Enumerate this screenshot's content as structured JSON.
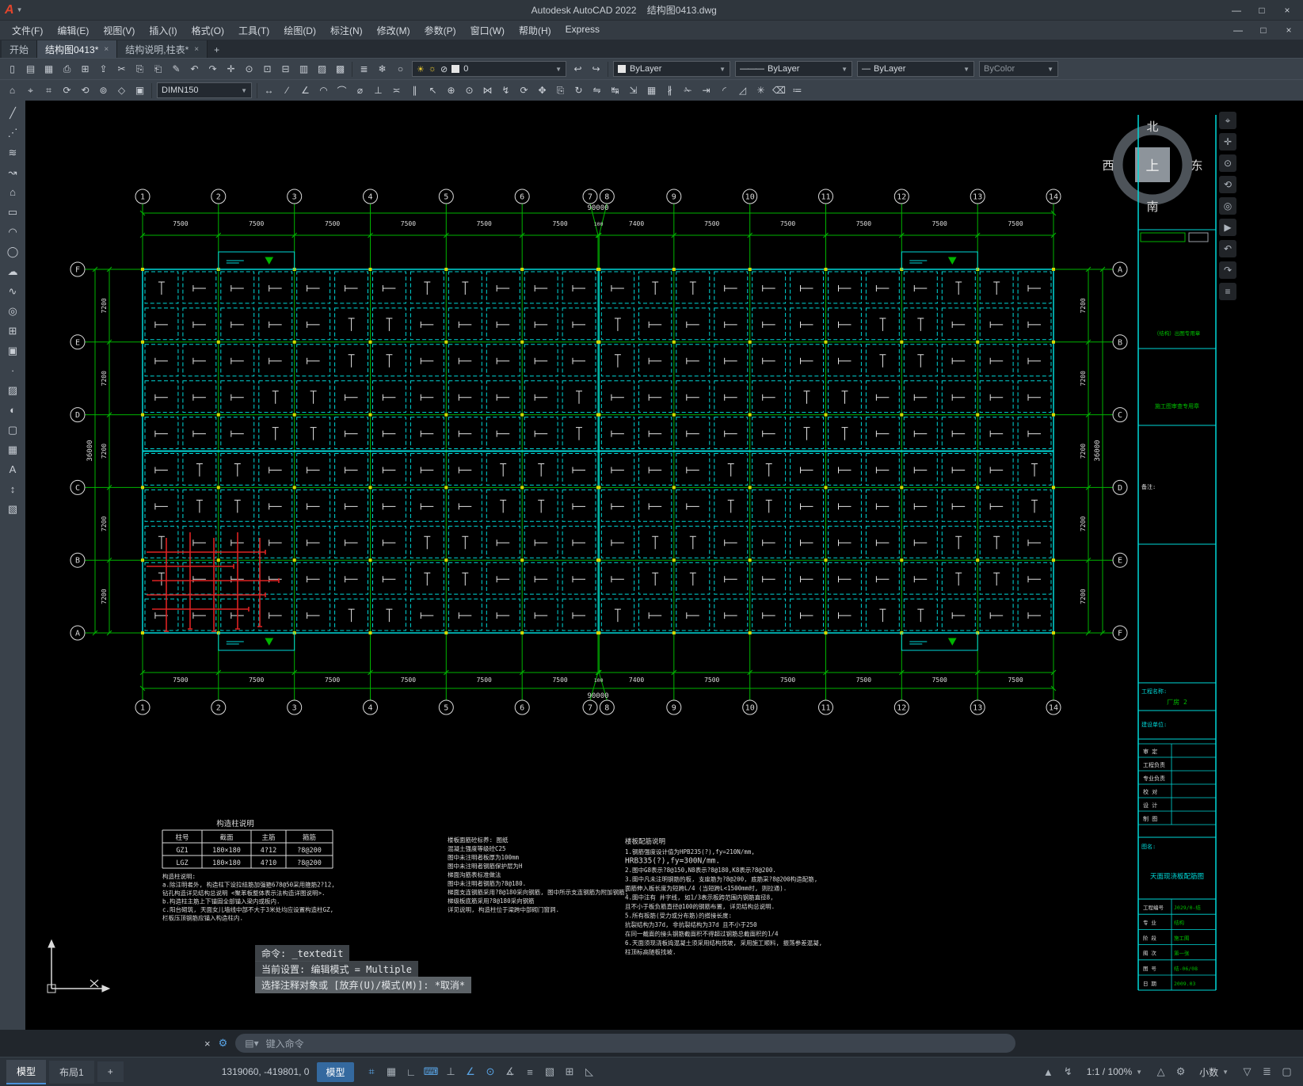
{
  "colors": {
    "grid_green": "#00b400",
    "dash_cyan": "#00d8d8",
    "text_white": "#dcdcdc",
    "rebar_red": "#dd2222",
    "column_yellow": "#d6d600",
    "accent_blue": "#4a90d9"
  },
  "window": {
    "app_title": "Autodesk AutoCAD 2022",
    "doc_title": "结构图0413.dwg",
    "min": "—",
    "max": "□",
    "close": "×"
  },
  "menu": {
    "items": [
      "文件(F)",
      "编辑(E)",
      "视图(V)",
      "插入(I)",
      "格式(O)",
      "工具(T)",
      "绘图(D)",
      "标注(N)",
      "修改(M)",
      "参数(P)",
      "窗口(W)",
      "帮助(H)",
      "Express"
    ]
  },
  "file_tabs": {
    "items": [
      {
        "label": "开始",
        "active": false,
        "closable": false
      },
      {
        "label": "结构图0413*",
        "active": true,
        "closable": true
      },
      {
        "label": "结构说明,柱表*",
        "active": false,
        "closable": true
      }
    ],
    "add_label": "+"
  },
  "toolbar1": {
    "icons": [
      {
        "name": "qnew",
        "glyph": "▯"
      },
      {
        "name": "open",
        "glyph": "▤"
      },
      {
        "name": "save",
        "glyph": "▦"
      },
      {
        "name": "plot",
        "glyph": "⎙"
      },
      {
        "name": "plot-preview",
        "glyph": "⊞"
      },
      {
        "name": "publish",
        "glyph": "⇪"
      },
      {
        "name": "cut",
        "glyph": "✂"
      },
      {
        "name": "copy-clip",
        "glyph": "⎘"
      },
      {
        "name": "paste",
        "glyph": "⎗"
      },
      {
        "name": "match-properties",
        "glyph": "✎"
      },
      {
        "name": "undo",
        "glyph": "↶"
      },
      {
        "name": "redo",
        "glyph": "↷"
      },
      {
        "name": "pan-realtime",
        "glyph": "✛"
      },
      {
        "name": "zoom-realtime",
        "glyph": "⊙"
      },
      {
        "name": "zoom-window",
        "glyph": "⊡"
      },
      {
        "name": "zoom-previous",
        "glyph": "⊟"
      },
      {
        "name": "sheet-set-manager",
        "glyph": "▥"
      },
      {
        "name": "markup",
        "glyph": "▨"
      },
      {
        "name": "quick-calc",
        "glyph": "▩"
      }
    ],
    "icons2": [
      {
        "name": "layer-properties",
        "glyph": "≣"
      },
      {
        "name": "layer-freeze",
        "glyph": "❄"
      },
      {
        "name": "layer-off",
        "glyph": "○"
      },
      {
        "name": "make-object-layer-current",
        "glyph": "↩"
      },
      {
        "name": "layer-previous",
        "glyph": "↪"
      }
    ],
    "layer_combo": {
      "value": "0"
    },
    "color_combo": "ByLayer",
    "linetype_combo": "ByLayer",
    "lineweight_combo": "ByLayer",
    "plotstyle_combo": "ByColor"
  },
  "toolbar2": {
    "dim_style": "DIMN150",
    "icons_left": [
      {
        "name": "workspace",
        "glyph": "⌂"
      },
      {
        "name": "ucs",
        "glyph": "⌖"
      },
      {
        "name": "units",
        "glyph": "⌗"
      },
      {
        "name": "redraw",
        "glyph": "⟳"
      },
      {
        "name": "regen",
        "glyph": "⟲"
      },
      {
        "name": "osnap-settings",
        "glyph": "⊚"
      },
      {
        "name": "isoplane",
        "glyph": "◇"
      },
      {
        "name": "group",
        "glyph": "▣"
      }
    ],
    "icons_right": [
      {
        "name": "dim-linear",
        "glyph": "↔"
      },
      {
        "name": "dim-aligned",
        "glyph": "∕"
      },
      {
        "name": "dim-angular",
        "glyph": "∠"
      },
      {
        "name": "dim-arc-length",
        "glyph": "◠"
      },
      {
        "name": "dim-radius",
        "glyph": "⌒"
      },
      {
        "name": "dim-diameter",
        "glyph": "⌀"
      },
      {
        "name": "dim-ordinate",
        "glyph": "⊥"
      },
      {
        "name": "dim-baseline",
        "glyph": "≍"
      },
      {
        "name": "dim-continue",
        "glyph": "∥"
      },
      {
        "name": "multileader",
        "glyph": "↖"
      },
      {
        "name": "tolerance",
        "glyph": "⊕"
      },
      {
        "name": "center-mark",
        "glyph": "⊙"
      },
      {
        "name": "dim-break",
        "glyph": "⋈"
      },
      {
        "name": "dim-jog",
        "glyph": "↯"
      },
      {
        "name": "dim-update",
        "glyph": "⟳"
      },
      {
        "name": "move",
        "glyph": "✥"
      },
      {
        "name": "copy-object",
        "glyph": "⎘"
      },
      {
        "name": "rotate",
        "glyph": "↻"
      },
      {
        "name": "mirror",
        "glyph": "⇋"
      },
      {
        "name": "stretch",
        "glyph": "↹"
      },
      {
        "name": "scale",
        "glyph": "⇲"
      },
      {
        "name": "array",
        "glyph": "▦"
      },
      {
        "name": "offset",
        "glyph": "∦"
      },
      {
        "name": "trim",
        "glyph": "✁"
      },
      {
        "name": "extend",
        "glyph": "⇥"
      },
      {
        "name": "fillet",
        "glyph": "◜"
      },
      {
        "name": "chamfer",
        "glyph": "◿"
      },
      {
        "name": "explode",
        "glyph": "✳"
      },
      {
        "name": "erase",
        "glyph": "⌫"
      },
      {
        "name": "properties",
        "glyph": "≔"
      }
    ]
  },
  "left_toolbar": {
    "icons": [
      {
        "name": "line",
        "glyph": "╱"
      },
      {
        "name": "construction-line",
        "glyph": "⋰"
      },
      {
        "name": "multiline",
        "glyph": "≋"
      },
      {
        "name": "polyline",
        "glyph": "↝"
      },
      {
        "name": "polygon",
        "glyph": "⌂"
      },
      {
        "name": "rectangle",
        "glyph": "▭"
      },
      {
        "name": "arc",
        "glyph": "◠"
      },
      {
        "name": "circle",
        "glyph": "◯"
      },
      {
        "name": "revision-cloud",
        "glyph": "☁"
      },
      {
        "name": "spline",
        "glyph": "∿"
      },
      {
        "name": "ellipse",
        "glyph": "◎"
      },
      {
        "name": "insert-block",
        "glyph": "⊞"
      },
      {
        "name": "make-block",
        "glyph": "▣"
      },
      {
        "name": "point",
        "glyph": "∙"
      },
      {
        "name": "hatch",
        "glyph": "▨"
      },
      {
        "name": "gradient",
        "glyph": "◐"
      },
      {
        "name": "region",
        "glyph": "▢"
      },
      {
        "name": "table",
        "glyph": "▦"
      },
      {
        "name": "text",
        "glyph": "A"
      },
      {
        "name": "dimension",
        "glyph": "↕"
      },
      {
        "name": "color-palette",
        "glyph": "▧"
      }
    ]
  },
  "nav_toolbar": {
    "icons": [
      {
        "name": "viewcube",
        "glyph": "⌖"
      },
      {
        "name": "pan",
        "glyph": "✛"
      },
      {
        "name": "zoom",
        "glyph": "⊙"
      },
      {
        "name": "orbit",
        "glyph": "⟲"
      },
      {
        "name": "steering-wheel",
        "glyph": "◎"
      },
      {
        "name": "show-motion",
        "glyph": "▶"
      },
      {
        "name": "previous-view",
        "glyph": "↶"
      },
      {
        "name": "next-view",
        "glyph": "↷"
      },
      {
        "name": "navigation-settings",
        "glyph": "≡"
      }
    ]
  },
  "plan": {
    "col_labels": [
      "1",
      "2",
      "3",
      "4",
      "5",
      "6",
      "7",
      "8",
      "9",
      "10",
      "11",
      "12",
      "13",
      "14"
    ],
    "col_bays": [
      7500,
      7500,
      7500,
      7500,
      7500,
      7500,
      100,
      7400,
      7500,
      7500,
      7500,
      7500,
      7500
    ],
    "bay_labels": [
      "7500",
      "7500",
      "7500",
      "7500",
      "7500",
      "7500",
      "100",
      "7400",
      "7500",
      "7500",
      "7500",
      "7500",
      "7500"
    ],
    "total_width": "90000",
    "row_labels_left": [
      "F",
      "E",
      "D",
      "C",
      "B",
      "A"
    ],
    "row_labels_right": [
      "A",
      "B",
      "C",
      "D",
      "E",
      "F"
    ],
    "row_spacing": "7200",
    "total_height": "36000"
  },
  "compass": {
    "n": "北",
    "s": "南",
    "w": "西",
    "e": "东",
    "center": "上"
  },
  "column_table": {
    "title": "构造柱说明",
    "headers": [
      "柱号",
      "截面",
      "主筋",
      "箍筋"
    ],
    "rows": [
      [
        "GZ1",
        "180×180",
        "4?12",
        "?8@200"
      ],
      [
        "LGZ",
        "180×180",
        "4?10",
        "?8@200"
      ]
    ]
  },
  "notes_left": {
    "lines": [
      "构造柱说明:",
      "a.除注明者外, 构造柱下设拉结筋加强箍678@50采用箍筋2?12,",
      "   钻孔构造详见结构总说明 <聚苯板整体表示法构造详图说明>.",
      "b.构造柱主筋上下锚固全部锚入梁内或板内.",
      "c.阳台砌筑, 天面女儿墙线中部不大于3米处均应设置构造柱GZ,",
      "   栏板压顶钢筋应锚入构造柱内."
    ]
  },
  "notes_mid": {
    "lines": [
      "楼板面筋砼标养: 图纸",
      "混凝土强度等级砼C25",
      "图中未注明者板厚为100mm",
      "图中未注明者钢筋保护层为H",
      "梯面沟筋表标准做法",
      "图中未注明者钢筋为?8@180.",
      "梯面支连钢筋采用?8@180采向钢筋, 图中所示支连钢筋为附加钢筋:",
      "梯级板底筋采用?8@180采向钢筋",
      "详见说明, 构造柱位于梁跨中部砌门窗洞."
    ]
  },
  "notes_right": {
    "title": "楼板配筋说明",
    "lines": [
      "1.钢筋强度设计值为HPB235(?),fy=210N/mm,",
      "          HRB335(?),fy=300N/mm.",
      "2.图中G8表示?8@150,N8表示?8@180,K8表示?8@200.",
      "3.图中凡未注明钢筋的板, 支座筋为?8@200, 底筋采?8@200构造配筋,",
      "   面筋伸入板长度为短跨L/4 (当短跨L<1500mm时, 则拉通).",
      "4.图中注有 井字线, 如1/3表示板跨范围内钢筋直径8,",
      "   且不小于板负筋直径@100的钢筋布置, 详见结构总说明.",
      "5.所有板筋(受力或分布筋)的搭接长度:",
      "   抗裂结构为37d, 非抗裂结构为37d 且不小于250",
      "   在同一截面的接头钢筋截面积不得超过钢筋总截面积的1/4",
      "6.天面须现浇板捣混凝土须采用结构找坡, 采用施工顺料, 振荡参差混凝,",
      "   柱顶标高随板找坡."
    ]
  },
  "titleblock": {
    "stamp1": "（结构）出图专用章",
    "stamp2": "施工图审查专用章",
    "note_label": "备注:",
    "project_label": "工程名称:",
    "project_value": "厂房 2",
    "client_label": "建设单位:",
    "staff": [
      "审 定",
      "工程负责",
      "专业负责",
      "校 对",
      "设 计",
      "制 图"
    ],
    "drawing_label": "图名:",
    "drawing_title": "天面现浇板配筋图",
    "info": [
      [
        "工程编号",
        "J029/0-结"
      ],
      [
        "专 业",
        "结构"
      ],
      [
        "阶 段",
        "施工图"
      ],
      [
        "图 次",
        "第一张"
      ],
      [
        "图 号",
        "结-06/08"
      ],
      [
        "日 期",
        "2009.03"
      ]
    ]
  },
  "command": {
    "history": [
      "命令: _textedit",
      "当前设置: 编辑模式 = Multiple",
      "选择注释对象或 [放弃(U)/模式(M)]: *取消*"
    ],
    "prompt": "键入命令"
  },
  "statusbar": {
    "model_tab": "模型",
    "layout_tab": "布局1",
    "add_tab": "+",
    "coords": "1319060, -419801, 0",
    "model_button": "模型",
    "left_icons": [
      {
        "name": "grid-display",
        "glyph": "⌗",
        "on": true
      },
      {
        "name": "snap-mode",
        "glyph": "▦"
      },
      {
        "name": "infer-constraints",
        "glyph": "∟"
      },
      {
        "name": "dynamic-input",
        "glyph": "⌨",
        "on": true
      },
      {
        "name": "ortho-mode",
        "glyph": "⊥"
      },
      {
        "name": "polar-tracking",
        "glyph": "∠",
        "on": true
      },
      {
        "name": "object-snap",
        "glyph": "⊙",
        "on": true
      },
      {
        "name": "object-snap-tracking",
        "glyph": "∡"
      },
      {
        "name": "lineweight-display",
        "glyph": "≡"
      },
      {
        "name": "transparency",
        "glyph": "▧"
      },
      {
        "name": "selection-cycling",
        "glyph": "⊞"
      },
      {
        "name": "dynamic-ucs",
        "glyph": "◺"
      }
    ],
    "right_icons_a": [
      {
        "name": "annotation-visibility",
        "glyph": "▲"
      },
      {
        "name": "autoscale",
        "glyph": "↯"
      }
    ],
    "scale": "1:1 / 100%",
    "right_icons_b": [
      {
        "name": "annotation-scale-sync",
        "glyph": "△"
      },
      {
        "name": "workspace-gear",
        "glyph": "⚙"
      }
    ],
    "precision": "小数",
    "right_icons_c": [
      {
        "name": "isolate-objects",
        "glyph": "▽"
      },
      {
        "name": "customize",
        "glyph": "≣"
      },
      {
        "name": "clean-screen",
        "glyph": "▢"
      }
    ]
  }
}
